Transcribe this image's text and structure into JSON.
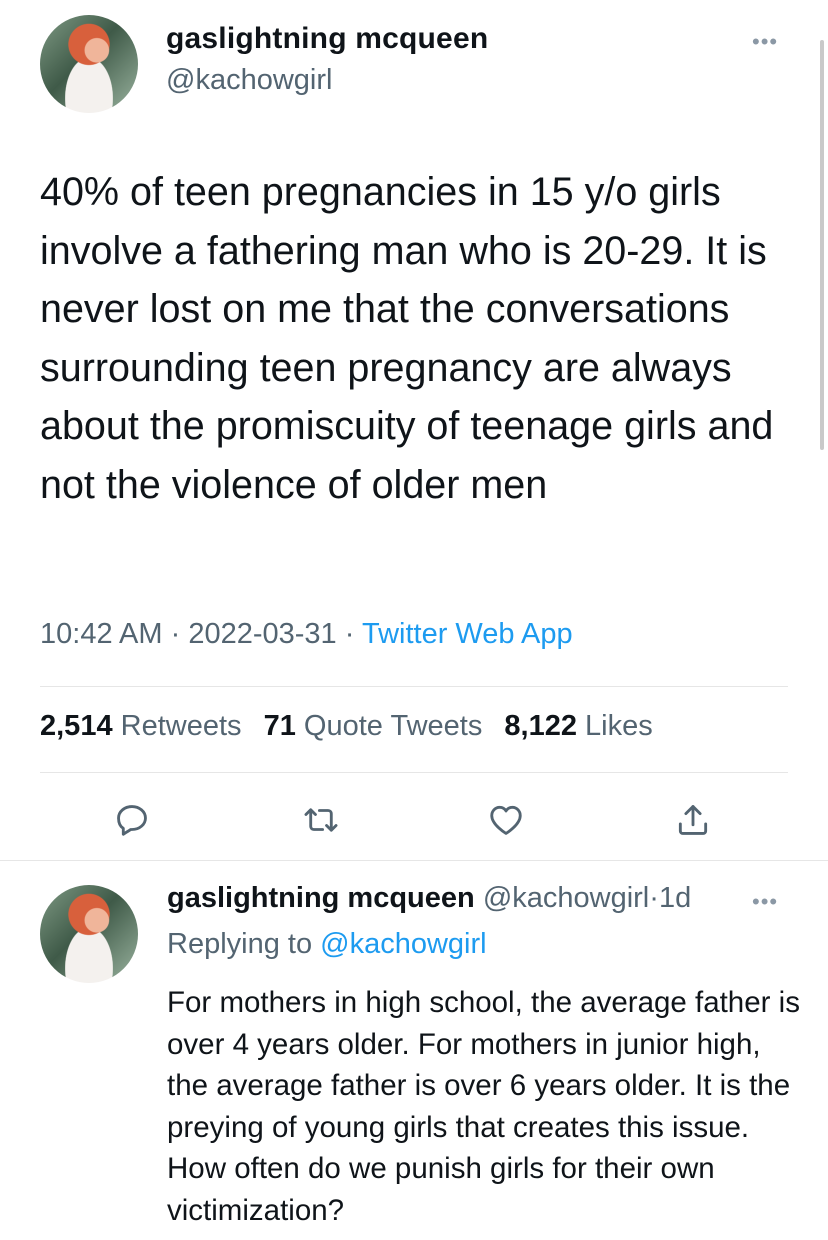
{
  "main_tweet": {
    "author_name": "gaslightning mcqueen",
    "author_handle": "@kachowgirl",
    "more_label": "•••",
    "text": "40% of teen pregnancies in 15 y/o girls involve a fathering man who is 20-29. It is never lost on me that the conversations surrounding teen pregnancy are always about the promiscuity of teenage girls and not the violence of older men",
    "time": "10:42 AM",
    "date": "2022-03-31",
    "source": "Twitter Web App",
    "separator": "·",
    "stats": {
      "retweets_count": "2,514",
      "retweets_label": "Retweets",
      "quotes_count": "71",
      "quotes_label": "Quote Tweets",
      "likes_count": "8,122",
      "likes_label": "Likes"
    },
    "actions": [
      "reply-icon",
      "retweet-icon",
      "like-icon",
      "share-icon"
    ]
  },
  "reply": {
    "author_name": "gaslightning mcqueen",
    "author_handle": "@kachowgirl",
    "time_ago": "1d",
    "separator": "·",
    "more_label": "•••",
    "replying_prefix": "Replying to",
    "replying_handle": "@kachowgirl",
    "text": "For mothers in high school, the average father is over 4 years older. For mothers in junior high, the average father is over 6 years older. It is the preying of young girls that creates this issue. How often do we punish girls for their own victimization?"
  },
  "colors": {
    "text_primary": "#0f1419",
    "text_secondary": "#536471",
    "link": "#1d9bf0",
    "divider": "#e6e6e6",
    "icon": "#536471"
  }
}
